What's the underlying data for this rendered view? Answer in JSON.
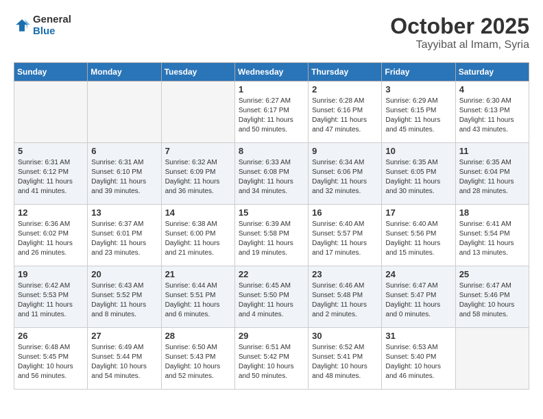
{
  "header": {
    "logo_line1": "General",
    "logo_line2": "Blue",
    "month": "October 2025",
    "location": "Tayyibat al Imam, Syria"
  },
  "days_of_week": [
    "Sunday",
    "Monday",
    "Tuesday",
    "Wednesday",
    "Thursday",
    "Friday",
    "Saturday"
  ],
  "weeks": [
    [
      {
        "day": "",
        "empty": true
      },
      {
        "day": "",
        "empty": true
      },
      {
        "day": "",
        "empty": true
      },
      {
        "day": "1",
        "line1": "Sunrise: 6:27 AM",
        "line2": "Sunset: 6:17 PM",
        "line3": "Daylight: 11 hours and 50 minutes."
      },
      {
        "day": "2",
        "line1": "Sunrise: 6:28 AM",
        "line2": "Sunset: 6:16 PM",
        "line3": "Daylight: 11 hours and 47 minutes."
      },
      {
        "day": "3",
        "line1": "Sunrise: 6:29 AM",
        "line2": "Sunset: 6:15 PM",
        "line3": "Daylight: 11 hours and 45 minutes."
      },
      {
        "day": "4",
        "line1": "Sunrise: 6:30 AM",
        "line2": "Sunset: 6:13 PM",
        "line3": "Daylight: 11 hours and 43 minutes."
      }
    ],
    [
      {
        "day": "5",
        "line1": "Sunrise: 6:31 AM",
        "line2": "Sunset: 6:12 PM",
        "line3": "Daylight: 11 hours and 41 minutes."
      },
      {
        "day": "6",
        "line1": "Sunrise: 6:31 AM",
        "line2": "Sunset: 6:10 PM",
        "line3": "Daylight: 11 hours and 39 minutes."
      },
      {
        "day": "7",
        "line1": "Sunrise: 6:32 AM",
        "line2": "Sunset: 6:09 PM",
        "line3": "Daylight: 11 hours and 36 minutes."
      },
      {
        "day": "8",
        "line1": "Sunrise: 6:33 AM",
        "line2": "Sunset: 6:08 PM",
        "line3": "Daylight: 11 hours and 34 minutes."
      },
      {
        "day": "9",
        "line1": "Sunrise: 6:34 AM",
        "line2": "Sunset: 6:06 PM",
        "line3": "Daylight: 11 hours and 32 minutes."
      },
      {
        "day": "10",
        "line1": "Sunrise: 6:35 AM",
        "line2": "Sunset: 6:05 PM",
        "line3": "Daylight: 11 hours and 30 minutes."
      },
      {
        "day": "11",
        "line1": "Sunrise: 6:35 AM",
        "line2": "Sunset: 6:04 PM",
        "line3": "Daylight: 11 hours and 28 minutes."
      }
    ],
    [
      {
        "day": "12",
        "line1": "Sunrise: 6:36 AM",
        "line2": "Sunset: 6:02 PM",
        "line3": "Daylight: 11 hours and 26 minutes."
      },
      {
        "day": "13",
        "line1": "Sunrise: 6:37 AM",
        "line2": "Sunset: 6:01 PM",
        "line3": "Daylight: 11 hours and 23 minutes."
      },
      {
        "day": "14",
        "line1": "Sunrise: 6:38 AM",
        "line2": "Sunset: 6:00 PM",
        "line3": "Daylight: 11 hours and 21 minutes."
      },
      {
        "day": "15",
        "line1": "Sunrise: 6:39 AM",
        "line2": "Sunset: 5:58 PM",
        "line3": "Daylight: 11 hours and 19 minutes."
      },
      {
        "day": "16",
        "line1": "Sunrise: 6:40 AM",
        "line2": "Sunset: 5:57 PM",
        "line3": "Daylight: 11 hours and 17 minutes."
      },
      {
        "day": "17",
        "line1": "Sunrise: 6:40 AM",
        "line2": "Sunset: 5:56 PM",
        "line3": "Daylight: 11 hours and 15 minutes."
      },
      {
        "day": "18",
        "line1": "Sunrise: 6:41 AM",
        "line2": "Sunset: 5:54 PM",
        "line3": "Daylight: 11 hours and 13 minutes."
      }
    ],
    [
      {
        "day": "19",
        "line1": "Sunrise: 6:42 AM",
        "line2": "Sunset: 5:53 PM",
        "line3": "Daylight: 11 hours and 11 minutes."
      },
      {
        "day": "20",
        "line1": "Sunrise: 6:43 AM",
        "line2": "Sunset: 5:52 PM",
        "line3": "Daylight: 11 hours and 8 minutes."
      },
      {
        "day": "21",
        "line1": "Sunrise: 6:44 AM",
        "line2": "Sunset: 5:51 PM",
        "line3": "Daylight: 11 hours and 6 minutes."
      },
      {
        "day": "22",
        "line1": "Sunrise: 6:45 AM",
        "line2": "Sunset: 5:50 PM",
        "line3": "Daylight: 11 hours and 4 minutes."
      },
      {
        "day": "23",
        "line1": "Sunrise: 6:46 AM",
        "line2": "Sunset: 5:48 PM",
        "line3": "Daylight: 11 hours and 2 minutes."
      },
      {
        "day": "24",
        "line1": "Sunrise: 6:47 AM",
        "line2": "Sunset: 5:47 PM",
        "line3": "Daylight: 11 hours and 0 minutes."
      },
      {
        "day": "25",
        "line1": "Sunrise: 6:47 AM",
        "line2": "Sunset: 5:46 PM",
        "line3": "Daylight: 10 hours and 58 minutes."
      }
    ],
    [
      {
        "day": "26",
        "line1": "Sunrise: 6:48 AM",
        "line2": "Sunset: 5:45 PM",
        "line3": "Daylight: 10 hours and 56 minutes."
      },
      {
        "day": "27",
        "line1": "Sunrise: 6:49 AM",
        "line2": "Sunset: 5:44 PM",
        "line3": "Daylight: 10 hours and 54 minutes."
      },
      {
        "day": "28",
        "line1": "Sunrise: 6:50 AM",
        "line2": "Sunset: 5:43 PM",
        "line3": "Daylight: 10 hours and 52 minutes."
      },
      {
        "day": "29",
        "line1": "Sunrise: 6:51 AM",
        "line2": "Sunset: 5:42 PM",
        "line3": "Daylight: 10 hours and 50 minutes."
      },
      {
        "day": "30",
        "line1": "Sunrise: 6:52 AM",
        "line2": "Sunset: 5:41 PM",
        "line3": "Daylight: 10 hours and 48 minutes."
      },
      {
        "day": "31",
        "line1": "Sunrise: 6:53 AM",
        "line2": "Sunset: 5:40 PM",
        "line3": "Daylight: 10 hours and 46 minutes."
      },
      {
        "day": "",
        "empty": true
      }
    ]
  ]
}
